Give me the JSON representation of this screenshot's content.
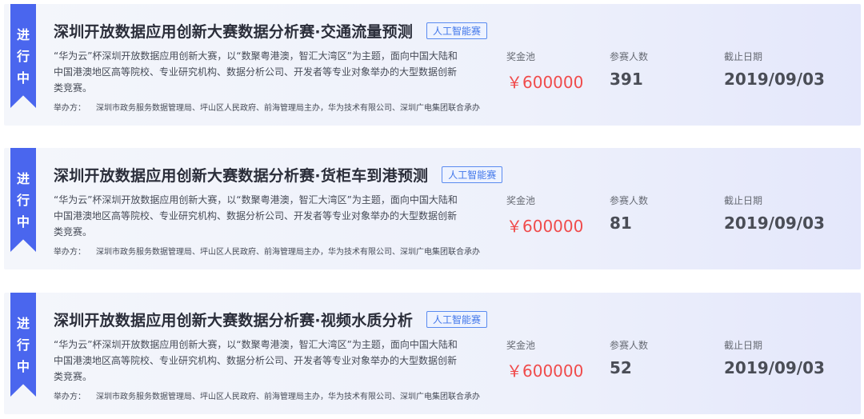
{
  "common": {
    "status_chars": [
      "进",
      "行",
      "中"
    ],
    "tag": "人工智能赛",
    "description": "“华为云”杯深圳开放数据应用创新大赛，以“数聚粤港澳，智汇大湾区”为主题，面向中国大陆和中国港澳地区高等院校、专业研究机构、数据分析公司、开发者等专业对象举办的大型数据创新类竞赛。",
    "org_label": "举办方：",
    "org_value": "深圳市政务服务数据管理局、坪山区人民政府、前海管理局主办，华为技术有限公司、深圳广电集团联合承办",
    "prize_label": "奖金池",
    "participants_label": "参赛人数",
    "deadline_label": "截止日期"
  },
  "competitions": [
    {
      "title": "深圳开放数据应用创新大赛数据分析赛·交通流量预测",
      "prize": "￥600000",
      "participants": "391",
      "deadline": "2019/09/03"
    },
    {
      "title": "深圳开放数据应用创新大赛数据分析赛·货柜车到港预测",
      "prize": "￥600000",
      "participants": "81",
      "deadline": "2019/09/03"
    },
    {
      "title": "深圳开放数据应用创新大赛数据分析赛·视频水质分析",
      "prize": "￥600000",
      "participants": "52",
      "deadline": "2019/09/03"
    }
  ],
  "colors": {
    "ribbon": "#4a66ee",
    "prize": "#f04b4b",
    "tag_border": "#5a8bf0"
  }
}
